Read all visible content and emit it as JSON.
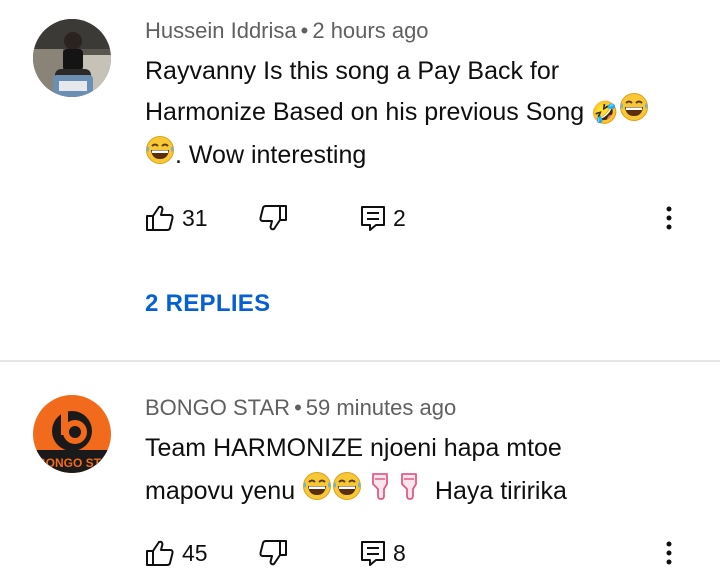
{
  "comments": [
    {
      "author": "Hussein Iddrisa",
      "time": "2 hours ago",
      "text_line1": "Rayvanny Is this song a Pay Back for",
      "text_line2": "Harmonize Based on his previous Song ",
      "text_line2_glyph": "🤣",
      "text_line3": ". Wow interesting",
      "likes": "31",
      "replies_count": "2",
      "replies_link": "2 REPLIES"
    },
    {
      "author": "BONGO STAR",
      "time": "59 minutes ago",
      "text_line1": "Team HARMONIZE njoeni hapa mtoe",
      "text_line2": "mapovu yenu",
      "text_line2_suffix": "Haya tiririka",
      "avatar_text": "BONGO ST",
      "likes": "45",
      "replies_count": "8"
    }
  ],
  "colors": {
    "meta": "#606060",
    "link": "#065fd4",
    "logo_orange": "#f26a1b"
  },
  "icons": [
    "like-icon",
    "dislike-icon",
    "reply-icon",
    "more-vert-icon",
    "laughing-emoji",
    "pointing-down-emoji"
  ]
}
